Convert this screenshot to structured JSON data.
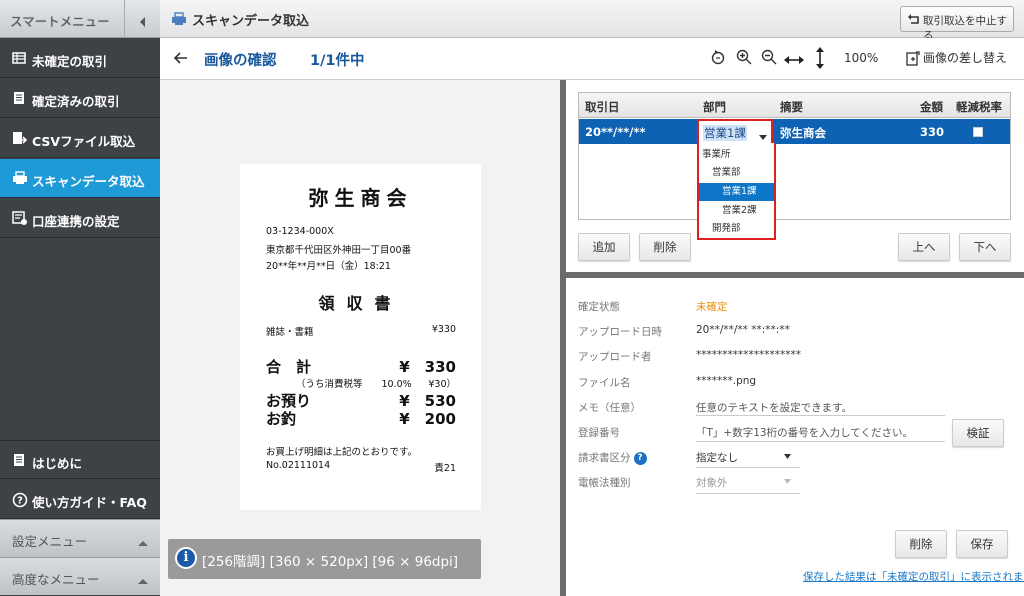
{
  "sidebar": {
    "title": "スマートメニュー",
    "items": [
      {
        "label": "未確定の取引",
        "icon": "table-icon"
      },
      {
        "label": "確定済みの取引",
        "icon": "document-icon"
      },
      {
        "label": "CSVファイル取込",
        "icon": "csv-import-icon"
      },
      {
        "label": "スキャンデータ取込",
        "icon": "scanner-icon",
        "active": true
      },
      {
        "label": "口座連携の設定",
        "icon": "bank-settings-icon"
      }
    ],
    "bottom": [
      {
        "label": "はじめに",
        "icon": "document-icon"
      },
      {
        "label": "使い方ガイド・FAQ",
        "icon": "help-circle-icon"
      }
    ],
    "submenus": [
      "設定メニュー",
      "高度なメニュー"
    ]
  },
  "header": {
    "title": "スキャンデータ取込",
    "cancel_label": "取引取込を中止する"
  },
  "toolbar": {
    "title": "画像の確認",
    "count": "1/1件中",
    "zoom": "100%",
    "replace_label": "画像の差し替え"
  },
  "receipt": {
    "store": "弥生商会",
    "phone": "03-1234-000X",
    "address": "東京都千代田区外神田一丁目00番",
    "datetime": "20**年**月**日（金）18:21",
    "title": "領収書",
    "item_name": "雑誌・書籍",
    "item_price": "¥330",
    "total_label": "合　計",
    "total_value": "¥　330",
    "tax_label": "（うち消費税等　　10.0%",
    "tax_value": "¥30）",
    "deposit_label": "お預り",
    "deposit_value": "¥　530",
    "change_label": "お釣",
    "change_value": "¥　200",
    "note": "お買上げ明細は上記のとおりです。",
    "number": "No.02111014",
    "staff": "責21"
  },
  "image_info": "[256階調] [360 × 520px] [96 × 96dpi]",
  "table": {
    "headers": [
      "取引日",
      "部門",
      "摘要",
      "金額",
      "軽減税率"
    ],
    "row": {
      "date": "20**/**/**",
      "dept": "営業1課",
      "desc": "弥生商会",
      "amount": "330"
    }
  },
  "dept_options": [
    "事業所",
    "営業部",
    "営業1課",
    "営業2課",
    "開発部"
  ],
  "buttons": {
    "add": "追加",
    "delete": "削除",
    "up": "上へ",
    "down": "下へ",
    "verify": "検証",
    "delete2": "削除",
    "save": "保存"
  },
  "detail": {
    "status_label": "確定状態",
    "status_value": "未確定",
    "upload_date_label": "アップロード日時",
    "upload_date_value": "20**/**/** **:**:**",
    "uploader_label": "アップロード者",
    "uploader_value": "********************",
    "filename_label": "ファイル名",
    "filename_value": "*******.png",
    "memo_label": "メモ（任意）",
    "memo_placeholder": "任意のテキストを設定できます。",
    "reg_label": "登録番号",
    "reg_placeholder": "「T」+数字13桁の番号を入力してください。",
    "invoice_label": "請求書区分",
    "invoice_value": "指定なし",
    "ebook_label": "電帳法種別",
    "ebook_value": "対象外"
  },
  "footer_link": "保存した結果は「未確定の取引」に表示されます",
  "colors": {
    "sidebar": "#3e4247",
    "active": "#1e9ad6",
    "title_blue": "#1a5a9c",
    "row_blue": "#0e62b3",
    "status_orange": "#e8900c",
    "highlight_red": "#e02020"
  }
}
